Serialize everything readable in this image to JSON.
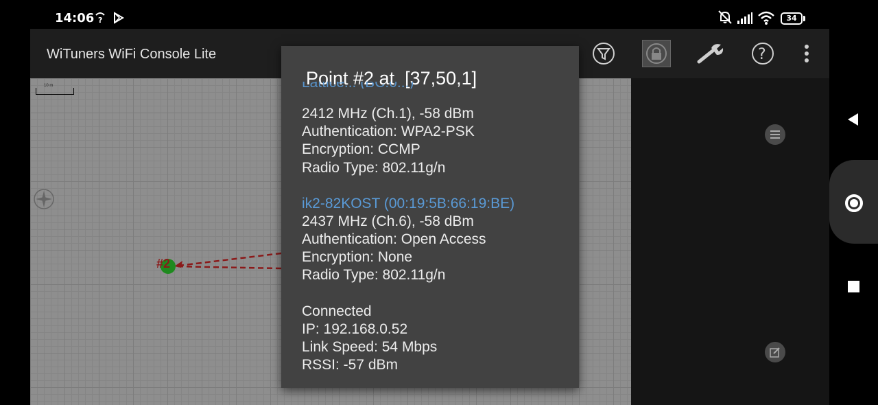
{
  "status_bar": {
    "time": "14:06",
    "battery": "34",
    "icons": [
      "wifi-calling-icon",
      "play-store-icon",
      "notification-off-icon",
      "signal-icon",
      "wifi-icon",
      "battery-icon"
    ]
  },
  "app": {
    "title": "WiTuners WiFi Console Lite",
    "toolbar_icons": [
      "filter-icon",
      "lock-icon",
      "wrench-icon",
      "help-icon",
      "overflow-menu-icon"
    ]
  },
  "map": {
    "scale_label": "10 m",
    "point_label": "#2",
    "colors": {
      "point": "#1f8a1f",
      "link": "#8b1a1a",
      "grid": "#8e8e8e"
    }
  },
  "dialog": {
    "title": "Point #2 at  [37,50,1]",
    "partial_top_name": "Lattice... (BC:0...)",
    "networks": [
      {
        "name": "",
        "lines": [
          "2412 MHz (Ch.1), -58 dBm",
          "Authentication: WPA2-PSK",
          "Encryption: CCMP",
          "Radio Type: 802.11g/n"
        ]
      },
      {
        "name": "ik2-82KOST (00:19:5B:66:19:BE)",
        "lines": [
          "2437 MHz (Ch.6), -58 dBm",
          "Authentication: Open Access",
          "Encryption: None",
          "Radio Type: 802.11g/n"
        ]
      }
    ],
    "connection": {
      "status": "Connected",
      "ip": "IP: 192.168.0.52",
      "link_speed": "Link Speed: 54 Mbps",
      "rssi": "RSSI: -57 dBm"
    },
    "partial_bottom_name": "........ (..:..:..:..:..:..)"
  },
  "navbar": {
    "icons": [
      "back-icon",
      "home-icon",
      "recents-icon"
    ]
  }
}
